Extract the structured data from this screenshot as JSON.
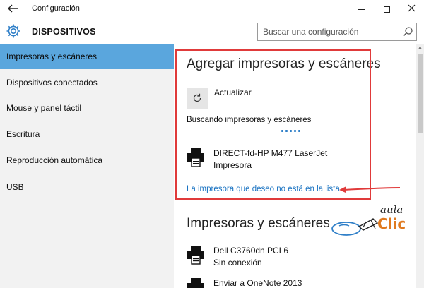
{
  "window": {
    "title": "Configuración"
  },
  "header": {
    "title": "DISPOSITIVOS",
    "icon": "gear-icon",
    "accent_color": "#2f7fc8"
  },
  "search": {
    "placeholder": "Buscar una configuración"
  },
  "sidebar": {
    "active_color": "#5aa6dd",
    "items": [
      {
        "label": "Impresoras y escáneres",
        "active": true
      },
      {
        "label": "Dispositivos conectados",
        "active": false
      },
      {
        "label": "Mouse y panel táctil",
        "active": false
      },
      {
        "label": "Escritura",
        "active": false
      },
      {
        "label": "Reproducción automática",
        "active": false
      },
      {
        "label": "USB",
        "active": false
      }
    ]
  },
  "main": {
    "add_section": {
      "title": "Agregar impresoras y escáneres",
      "refresh_label": "Actualizar",
      "searching_label": "Buscando impresoras y escáneres",
      "found_device": {
        "name": "DIRECT-fd-HP M477 LaserJet",
        "type": "Impresora",
        "icon": "printer-icon"
      },
      "missing_link": "La impresora que deseo no está en la lista"
    },
    "list_section": {
      "title": "Impresoras y escáneres",
      "devices": [
        {
          "name": "Dell C3760dn PCL6",
          "status": "Sin conexión",
          "icon": "printer-icon"
        },
        {
          "name": "Enviar a OneNote 2013",
          "status": "",
          "icon": "printer-icon"
        }
      ]
    }
  },
  "annotation": {
    "highlight_color": "#e03a3a"
  },
  "watermark": {
    "line1": "aula",
    "line2": "Clic",
    "brand_color": "#e07a1f"
  }
}
